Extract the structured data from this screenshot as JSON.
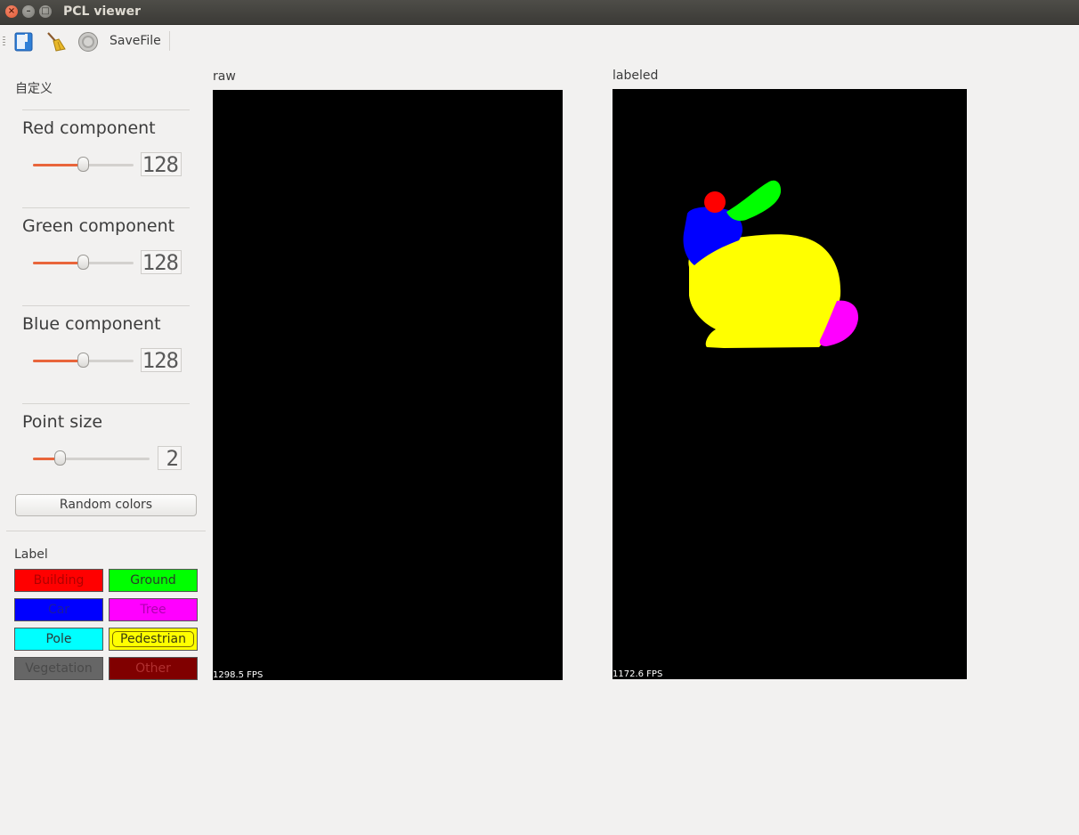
{
  "window": {
    "title": "PCL viewer"
  },
  "toolbar": {
    "save_label": "SaveFile"
  },
  "panel": {
    "group_title": "自定义",
    "red": {
      "title": "Red component",
      "value": "128",
      "level": 0.5
    },
    "green": {
      "title": "Green component",
      "value": "128",
      "level": 0.5
    },
    "blue": {
      "title": "Blue component",
      "value": "128",
      "level": 0.5
    },
    "point_size": {
      "title": "Point size",
      "value": "2",
      "level": 0.2
    },
    "random_button": "Random colors",
    "label_title": "Label",
    "labels": [
      {
        "text": "Building",
        "bg": "#ff0000",
        "fg": "#b00000"
      },
      {
        "text": "Ground",
        "bg": "#00ff00",
        "fg": "#2a3a2a"
      },
      {
        "text": "Car",
        "bg": "#0000ff",
        "fg": "#1a1aa0"
      },
      {
        "text": "Tree",
        "bg": "#ff00ff",
        "fg": "#b000b0"
      },
      {
        "text": "Pole",
        "bg": "#00ffff",
        "fg": "#2a3a3a"
      },
      {
        "text": "Pedestrian",
        "bg": "#ffff00",
        "fg": "#3a3a10"
      },
      {
        "text": "Vegetation",
        "bg": "#666666",
        "fg": "#4a4a4a"
      },
      {
        "text": "Other",
        "bg": "#800000",
        "fg": "#b03030"
      }
    ]
  },
  "viewers": {
    "raw": {
      "title": "raw",
      "fps": "1298.5 FPS"
    },
    "labeled": {
      "title": "labeled",
      "fps": "1172.6 FPS"
    }
  }
}
